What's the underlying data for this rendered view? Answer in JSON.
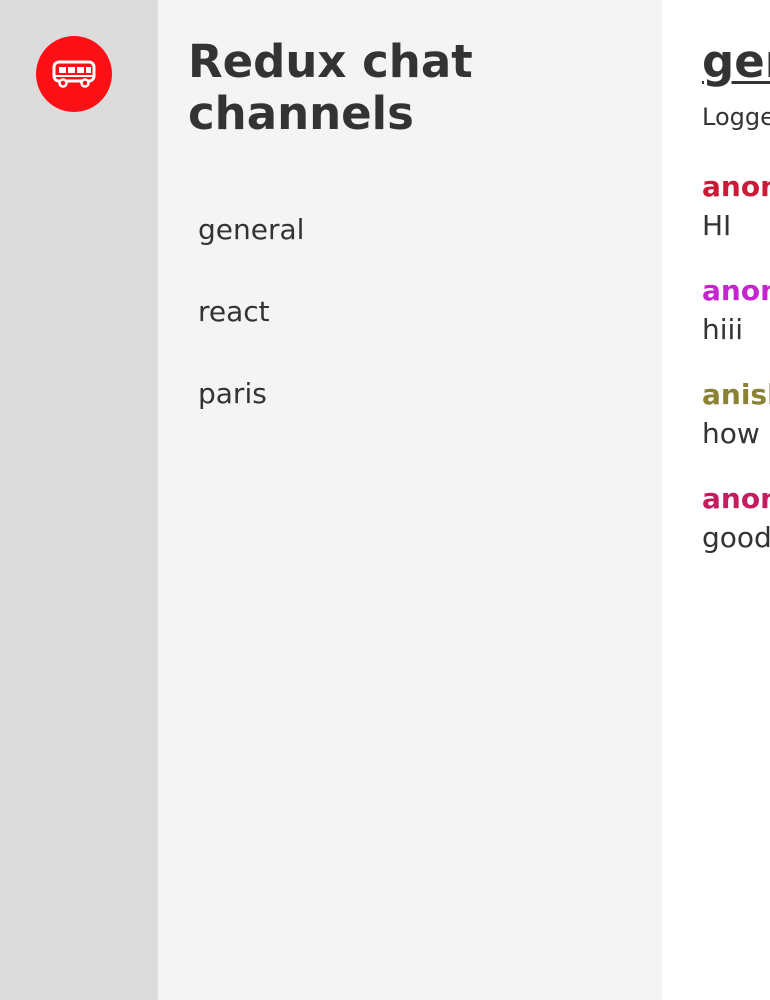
{
  "rail": {
    "logo_icon": "bus-icon",
    "logo_color": "#fd1015"
  },
  "channels": {
    "title": "Redux chat channels",
    "items": [
      {
        "label": "general"
      },
      {
        "label": "react"
      },
      {
        "label": "paris"
      }
    ]
  },
  "chat": {
    "title": "ger",
    "logged_as": "Logge",
    "messages": [
      {
        "author": "anon",
        "text": "HI",
        "color": "#cc1a36"
      },
      {
        "author": "anon",
        "text": "hiii",
        "color": "#c525d0"
      },
      {
        "author": "anish",
        "text": "how a",
        "color": "#8c8234"
      },
      {
        "author": "anon",
        "text": "good",
        "color": "#c51b5f"
      }
    ]
  }
}
